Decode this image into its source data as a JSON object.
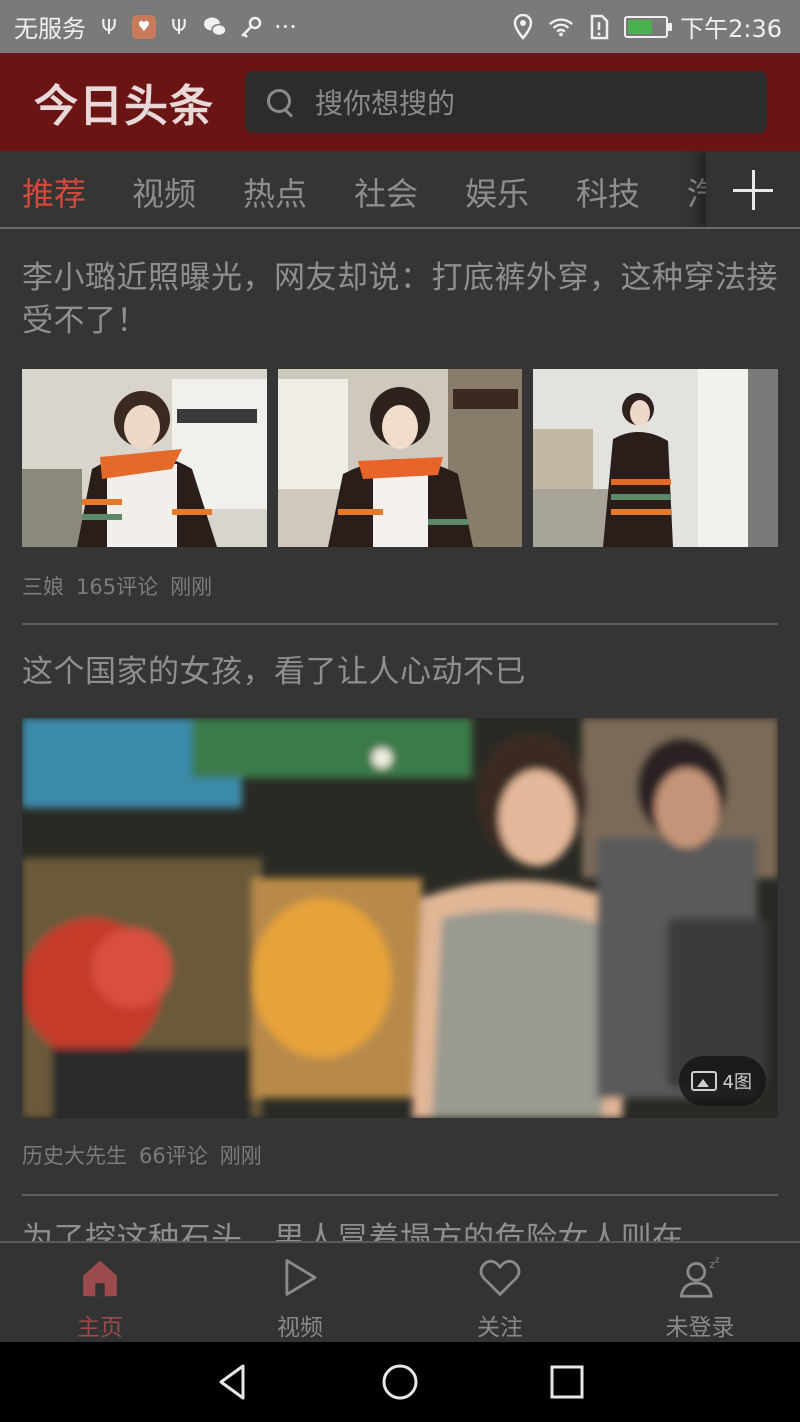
{
  "status_bar": {
    "carrier": "无服务",
    "more": "···",
    "time": "下午2:36",
    "icons": [
      "usb-icon",
      "app-notification-icon",
      "usb-icon",
      "wechat-icon",
      "key-icon",
      "location-icon",
      "wifi-icon",
      "sim-alert-icon",
      "battery-charging-icon"
    ]
  },
  "header": {
    "logo": "今日头条",
    "search_placeholder": "搜你想搜的"
  },
  "tabs": {
    "items": [
      "推荐",
      "视频",
      "热点",
      "社会",
      "娱乐",
      "科技",
      "汽"
    ],
    "active_index": 0,
    "add_icon": "plus-icon"
  },
  "feed": {
    "articles": [
      {
        "title": "李小璐近照曝光，网友却说：打底裤外穿，这种穿法接受不了！",
        "source": "三娘",
        "comments": "165评论",
        "time": "刚刚",
        "layout": "three-images"
      },
      {
        "title": "这个国家的女孩，看了让人心动不已",
        "source": "历史大先生",
        "comments": "66评论",
        "time": "刚刚",
        "photo_count": "4图",
        "layout": "large-image"
      },
      {
        "title": "为了挖这种石头，男人冒着塌方的危险女人则在",
        "layout": "partial"
      }
    ]
  },
  "bottom_nav": {
    "items": [
      {
        "label": "主页",
        "icon": "home-icon",
        "active": true
      },
      {
        "label": "视频",
        "icon": "play-icon",
        "active": false
      },
      {
        "label": "关注",
        "icon": "heart-icon",
        "active": false
      },
      {
        "label": "未登录",
        "icon": "user-sleep-icon",
        "active": false
      }
    ]
  },
  "colors": {
    "header_bg": "#6a1414",
    "accent": "#d24a3c",
    "background": "#353535"
  }
}
